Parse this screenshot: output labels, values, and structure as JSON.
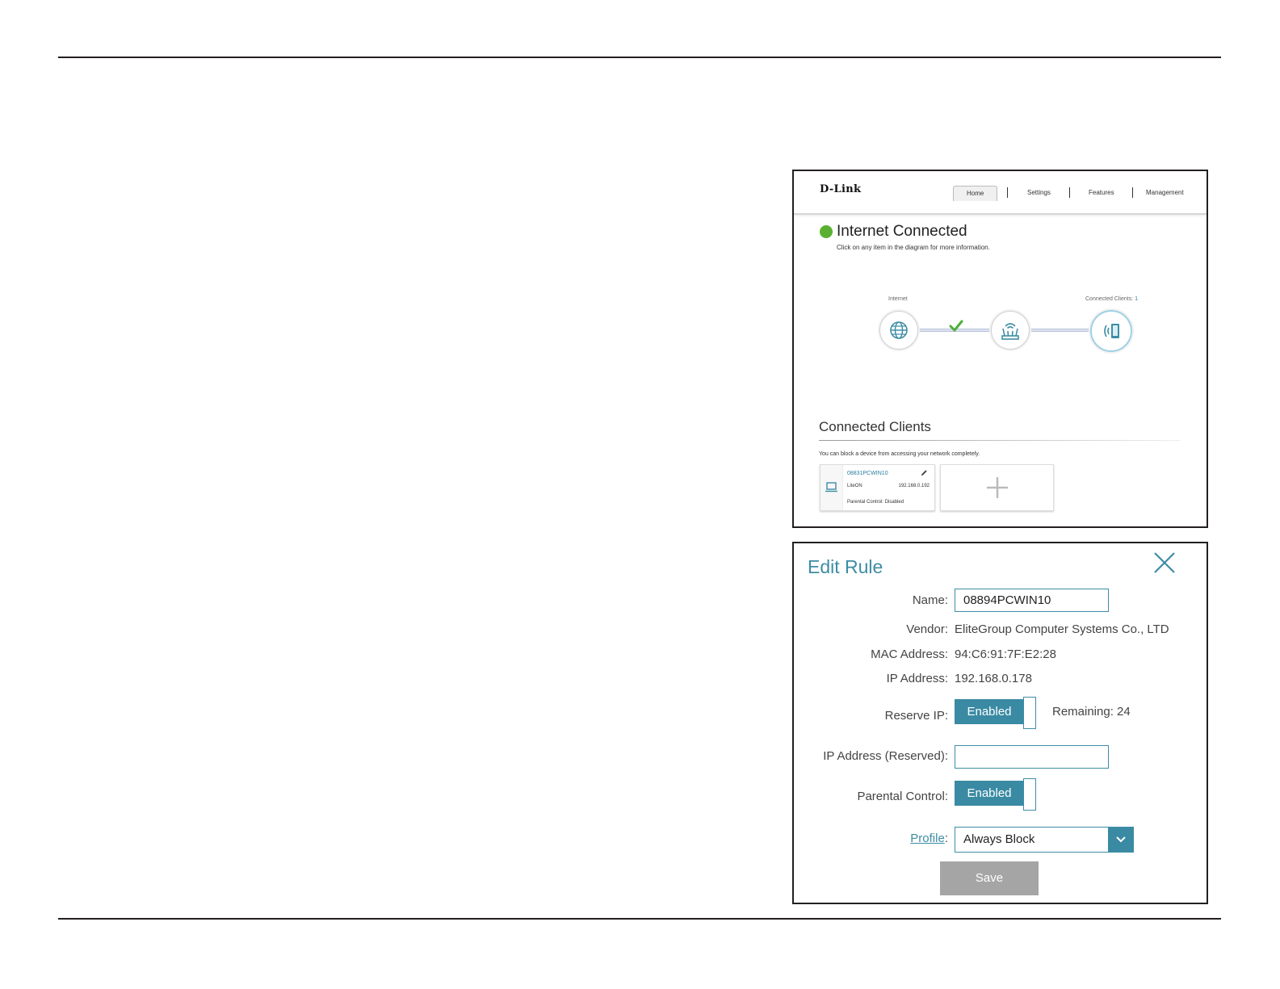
{
  "home": {
    "logo": "D-Link",
    "nav": [
      "Home",
      "Settings",
      "Features",
      "Management"
    ],
    "status_title": "Internet Connected",
    "status_subtitle": "Click on any item in the diagram for more information.",
    "internet_label": "Internet",
    "clients_label": "Connected Clients:",
    "clients_count": "1",
    "connected_clients_title": "Connected Clients",
    "connected_clients_sub": "You can block a device from accessing your network completely.",
    "client_card": {
      "name": "08831PCWIN10",
      "vendor": "LiteON",
      "ip": "192.168.0.192",
      "parental": "Parental Control: Disabled"
    },
    "colors": {
      "status_green": "#5ab031",
      "accent": "#3d8da5"
    }
  },
  "edit_rule": {
    "title": "Edit Rule",
    "name_label": "Name:",
    "name_value": "08894PCWIN10",
    "vendor_label": "Vendor:",
    "vendor_value": "EliteGroup Computer Systems Co., LTD",
    "mac_label": "MAC Address:",
    "mac_value": "94:C6:91:7F:E2:28",
    "ip_label": "IP Address:",
    "ip_value": "192.168.0.178",
    "reserve_label": "Reserve IP:",
    "reserve_state": "Enabled",
    "remaining": "Remaining: 24",
    "reserved_ip_label": "IP Address (Reserved):",
    "reserved_ip_value": "",
    "parental_label": "Parental Control:",
    "parental_state": "Enabled",
    "profile_label": "Profile",
    "profile_colon": ":",
    "profile_value": "Always Block",
    "save_label": "Save"
  }
}
